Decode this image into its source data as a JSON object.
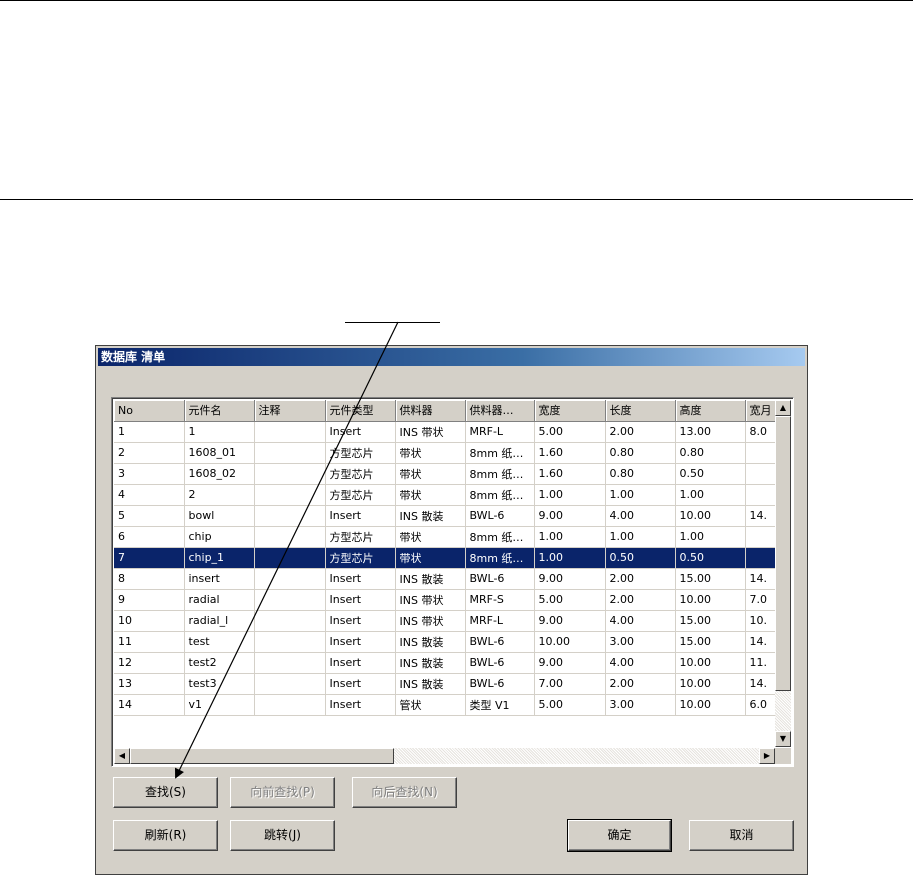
{
  "dialog": {
    "title": "数据库 清单",
    "columns": [
      "No",
      "元件名",
      "注释",
      "元件类型",
      "供料器",
      "供料器…",
      "宽度",
      "长度",
      "高度",
      "宽月"
    ],
    "rows": [
      [
        "1",
        "1",
        "",
        "Insert",
        "INS 带状",
        "MRF-L",
        "5.00",
        "2.00",
        "13.00",
        "8.0"
      ],
      [
        "2",
        "1608_01",
        "",
        "方型芯片",
        "带状",
        "8mm 纸…",
        "1.60",
        "0.80",
        "0.80",
        ""
      ],
      [
        "3",
        "1608_02",
        "",
        "方型芯片",
        "带状",
        "8mm 纸…",
        "1.60",
        "0.80",
        "0.50",
        ""
      ],
      [
        "4",
        "2",
        "",
        "方型芯片",
        "带状",
        "8mm 纸…",
        "1.00",
        "1.00",
        "1.00",
        ""
      ],
      [
        "5",
        "bowl",
        "",
        "Insert",
        "INS 散装",
        "BWL-6",
        "9.00",
        "4.00",
        "10.00",
        "14."
      ],
      [
        "6",
        "chip",
        "",
        "方型芯片",
        "带状",
        "8mm 纸…",
        "1.00",
        "1.00",
        "1.00",
        ""
      ],
      [
        "7",
        "chip_1",
        "",
        "方型芯片",
        "带状",
        "8mm 纸…",
        "1.00",
        "0.50",
        "0.50",
        ""
      ],
      [
        "8",
        "insert",
        "",
        "Insert",
        "INS 散装",
        "BWL-6",
        "9.00",
        "2.00",
        "15.00",
        "14."
      ],
      [
        "9",
        "radial",
        "",
        "Insert",
        "INS 带状",
        "MRF-S",
        "5.00",
        "2.00",
        "10.00",
        "7.0"
      ],
      [
        "10",
        "radial_l",
        "",
        "Insert",
        "INS 带状",
        "MRF-L",
        "9.00",
        "4.00",
        "15.00",
        "10."
      ],
      [
        "11",
        "test",
        "",
        "Insert",
        "INS 散装",
        "BWL-6",
        "10.00",
        "3.00",
        "15.00",
        "14."
      ],
      [
        "12",
        "test2",
        "",
        "Insert",
        "INS 散装",
        "BWL-6",
        "9.00",
        "4.00",
        "10.00",
        "11."
      ],
      [
        "13",
        "test3",
        "",
        "Insert",
        "INS 散装",
        "BWL-6",
        "7.00",
        "2.00",
        "10.00",
        "14."
      ],
      [
        "14",
        "v1",
        "",
        "Insert",
        "管状",
        "类型 V1",
        "5.00",
        "3.00",
        "10.00",
        "6.0"
      ]
    ],
    "selected_row": 6,
    "buttons": {
      "search": "查找(S)",
      "search_prev": "向前查找(P)",
      "search_next": "向后查找(N)",
      "refresh": "刷新(R)",
      "jump": "跳转(J)",
      "ok": "确定",
      "cancel": "取消"
    }
  },
  "colors": {
    "selection": "#0a246a",
    "dialog_face": "#d4d0c8"
  }
}
